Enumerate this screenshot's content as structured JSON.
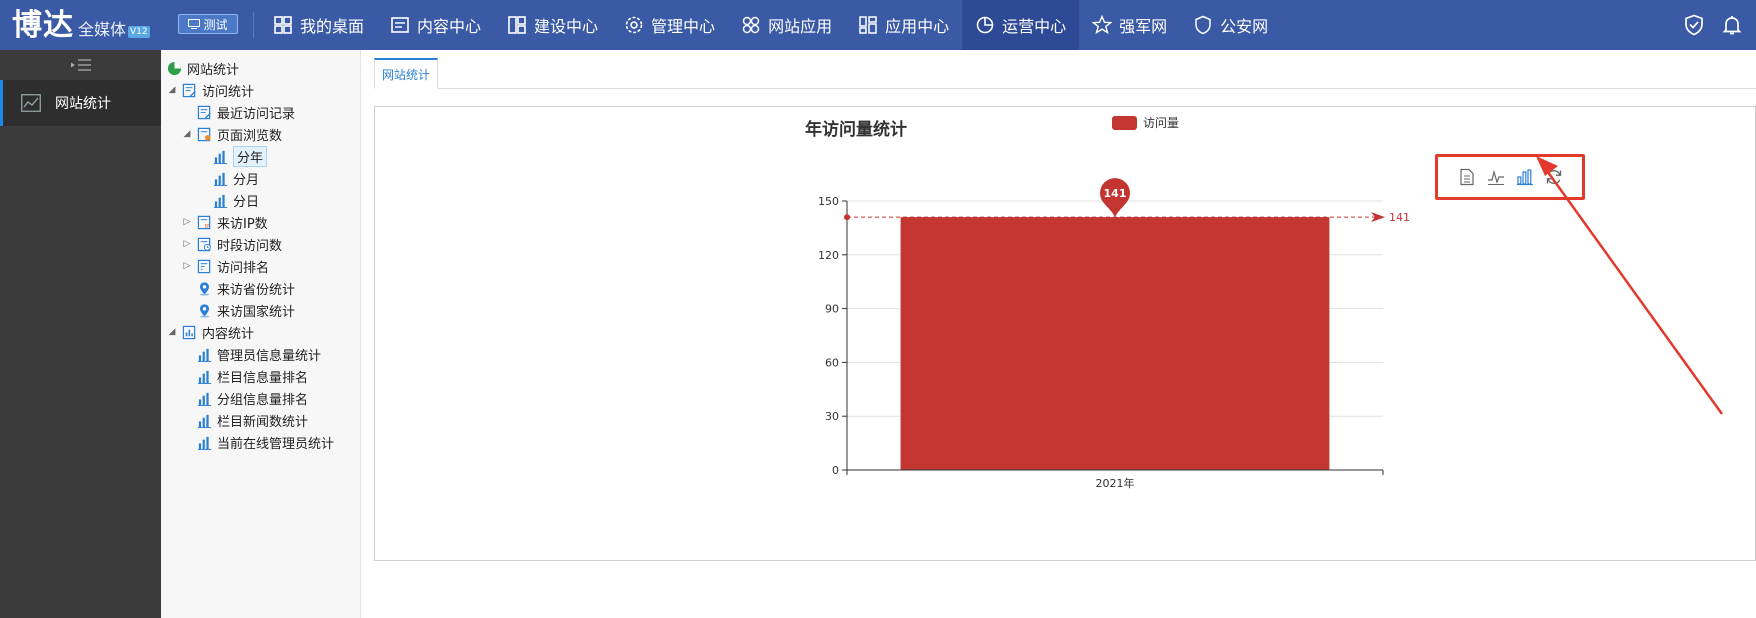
{
  "app": {
    "logo_main": "博达",
    "logo_sub": "全媒体",
    "logo_version": "V12",
    "env_label": "测试"
  },
  "nav": [
    {
      "label": "我的桌面",
      "icon": "grid-icon"
    },
    {
      "label": "内容中心",
      "icon": "document-list-icon"
    },
    {
      "label": "建设中心",
      "icon": "layout-icon"
    },
    {
      "label": "管理中心",
      "icon": "gear-icon"
    },
    {
      "label": "网站应用",
      "icon": "apps-icon"
    },
    {
      "label": "应用中心",
      "icon": "blocks-icon"
    },
    {
      "label": "运营中心",
      "icon": "pie-chart-icon",
      "active": true
    },
    {
      "label": "强军网",
      "icon": "star-icon"
    },
    {
      "label": "公安网",
      "icon": "shield-icon"
    }
  ],
  "sidebar": {
    "items": [
      {
        "label": "网站统计",
        "icon": "line-chart-icon"
      }
    ]
  },
  "tree": {
    "root": "网站统计",
    "visit": "访问统计",
    "recent": "最近访问记录",
    "pageviews": "页面浏览数",
    "by_year": "分年",
    "by_month": "分月",
    "by_day": "分日",
    "ip": "来访IP数",
    "period": "时段访问数",
    "rank": "访问排名",
    "province": "来访省份统计",
    "country": "来访国家统计",
    "content": "内容统计",
    "admin_info": "管理员信息量统计",
    "column_rank": "栏目信息量排名",
    "group_rank": "分组信息量排名",
    "column_news": "栏目新闻数统计",
    "online_admin": "当前在线管理员统计"
  },
  "tab": {
    "label": "网站统计"
  },
  "colors": {
    "topbar": "#3a5aa6",
    "bar": "#c23531",
    "highlight": "#e33a2d"
  },
  "chart_data": {
    "type": "bar",
    "title": "年访问量统计",
    "categories": [
      "2021年"
    ],
    "series": [
      {
        "name": "访问量",
        "values": [
          141
        ]
      }
    ],
    "ylim": [
      0,
      150
    ],
    "yticks": [
      0,
      30,
      60,
      90,
      120,
      150
    ],
    "max_pin_label": "141",
    "average_line_label": "141",
    "grid": true,
    "legend": "top-center",
    "toolbox": [
      "data-view-icon",
      "line-chart-icon",
      "bar-chart-icon",
      "restore-icon"
    ]
  }
}
